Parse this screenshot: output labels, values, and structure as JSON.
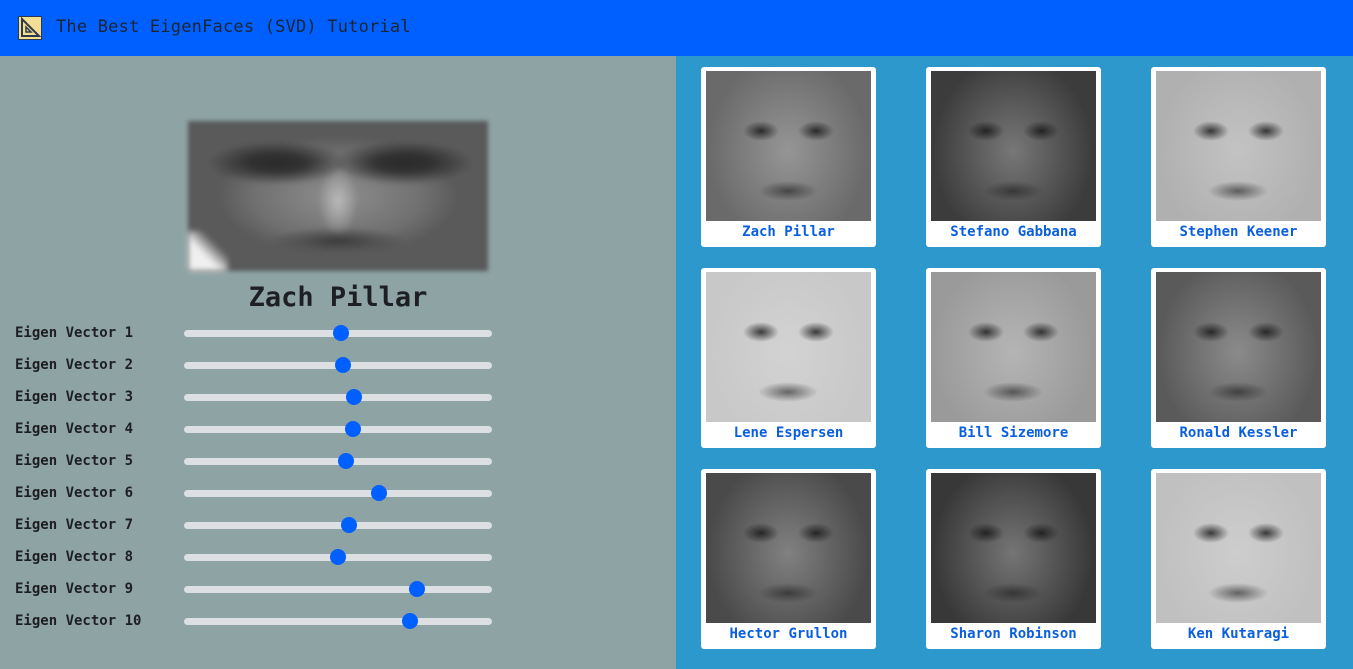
{
  "app": {
    "title": "The Best EigenFaces (SVD) Tutorial",
    "accent": "#0060ff"
  },
  "reconstruction": {
    "person": "Zach Pillar"
  },
  "sliders": [
    {
      "label": "Eigen Vector 1",
      "value": 0.51
    },
    {
      "label": "Eigen Vector 2",
      "value": 0.515
    },
    {
      "label": "Eigen Vector 3",
      "value": 0.552
    },
    {
      "label": "Eigen Vector 4",
      "value": 0.548
    },
    {
      "label": "Eigen Vector 5",
      "value": 0.526
    },
    {
      "label": "Eigen Vector 6",
      "value": 0.633
    },
    {
      "label": "Eigen Vector 7",
      "value": 0.536
    },
    {
      "label": "Eigen Vector 8",
      "value": 0.5
    },
    {
      "label": "Eigen Vector 9",
      "value": 0.756
    },
    {
      "label": "Eigen Vector 10",
      "value": 0.735
    }
  ],
  "gallery": [
    {
      "name": "Zach Pillar",
      "tone": "#6a6a6a"
    },
    {
      "name": "Stefano Gabbana",
      "tone": "#3c3c3c"
    },
    {
      "name": "Stephen Keener",
      "tone": "#b0b0b0"
    },
    {
      "name": "Lene Espersen",
      "tone": "#c8c8c8"
    },
    {
      "name": "Bill Sizemore",
      "tone": "#9a9a9a"
    },
    {
      "name": "Ronald Kessler",
      "tone": "#5a5a5a"
    },
    {
      "name": "Hector Grullon",
      "tone": "#4a4a4a"
    },
    {
      "name": "Sharon Robinson",
      "tone": "#383838"
    },
    {
      "name": "Ken Kutaragi",
      "tone": "#c0c0c0"
    }
  ]
}
